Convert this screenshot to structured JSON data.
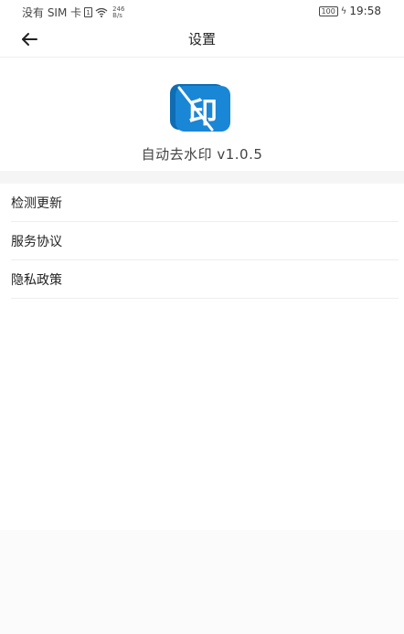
{
  "status_bar": {
    "carrier": "没有 SIM 卡",
    "sim_label": "1",
    "net_speed_value": "246",
    "net_speed_unit": "B/s",
    "battery": "100",
    "time": "19:58"
  },
  "nav": {
    "title": "设置"
  },
  "about": {
    "logo_char": "印",
    "app_version": "自动去水印 v1.0.5"
  },
  "settings": {
    "items": [
      {
        "label": "检测更新"
      },
      {
        "label": "服务协议"
      },
      {
        "label": "隐私政策"
      }
    ]
  },
  "colors": {
    "logo_blue": "#1a86d6",
    "logo_dark": "#0f6db4"
  }
}
